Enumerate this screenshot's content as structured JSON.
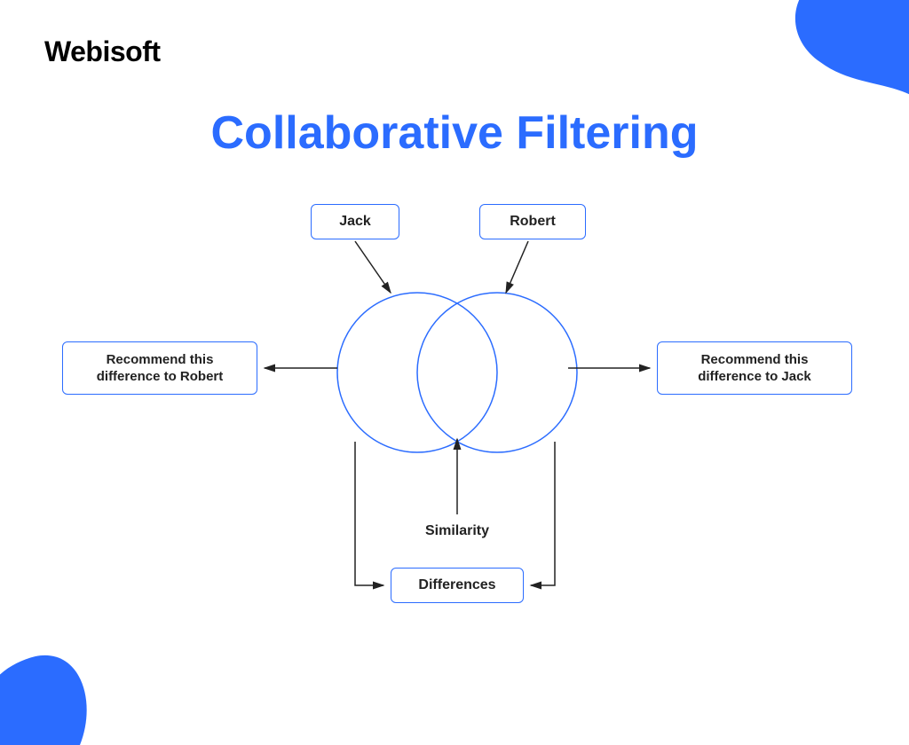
{
  "brand": "Webisoft",
  "title": "Collaborative Filtering",
  "colors": {
    "accent": "#2b6cff",
    "text": "#222222"
  },
  "nodes": {
    "jack": "Jack",
    "robert": "Robert",
    "recommend_to_robert": "Recommend this difference to Robert",
    "recommend_to_jack": "Recommend this difference to Jack",
    "differences": "Differences",
    "similarity": "Similarity"
  }
}
